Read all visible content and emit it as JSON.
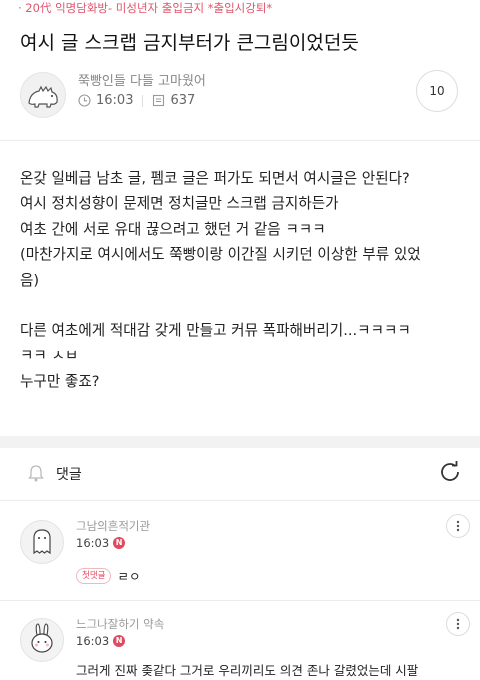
{
  "board": {
    "label": "· 20代 익명담화방- 미성년자 출입금지 *출입시강퇴*"
  },
  "post": {
    "title": "여시 글 스크랩 금지부터가 큰그림이었던듯",
    "author": "쭉빵인들 다들 고마웠어",
    "time": "16:03",
    "views": "637",
    "comment_count": "10",
    "body": [
      "온갖 일베급 남초 글, 펨코 글은 퍼가도 되면서 여시글은 안된다?",
      "여시 정치성향이 문제면 정치글만 스크랩 금지하든가",
      "여초 간에 서로 유대 끊으려고 했던 거 같음 ㅋㅋㅋ",
      "(마찬가지로 여시에서도 쭉빵이랑 이간질 시키던 이상한 부류 있었",
      "음)",
      "",
      "다른 여초에게 적대감 갖게 만들고 커뮤 폭파해버리기...ㅋㅋㅋㅋ",
      "ㅋㅋ ㅅㅂ",
      "누구만 좋죠?"
    ]
  },
  "comments_header": {
    "label": "댓글"
  },
  "comments": [
    {
      "name": "그남의흔적기관",
      "time": "16:03",
      "new_badge": "N",
      "tag": "첫댓글",
      "text": "ㄹㅇ"
    },
    {
      "name": "느그나잘하기 약속",
      "time": "16:03",
      "new_badge": "N",
      "tag": "",
      "text": "그러게 진짜 좆같다 그거로 우리끼리도 의견 존나 갈렸었는데 시팔"
    }
  ]
}
